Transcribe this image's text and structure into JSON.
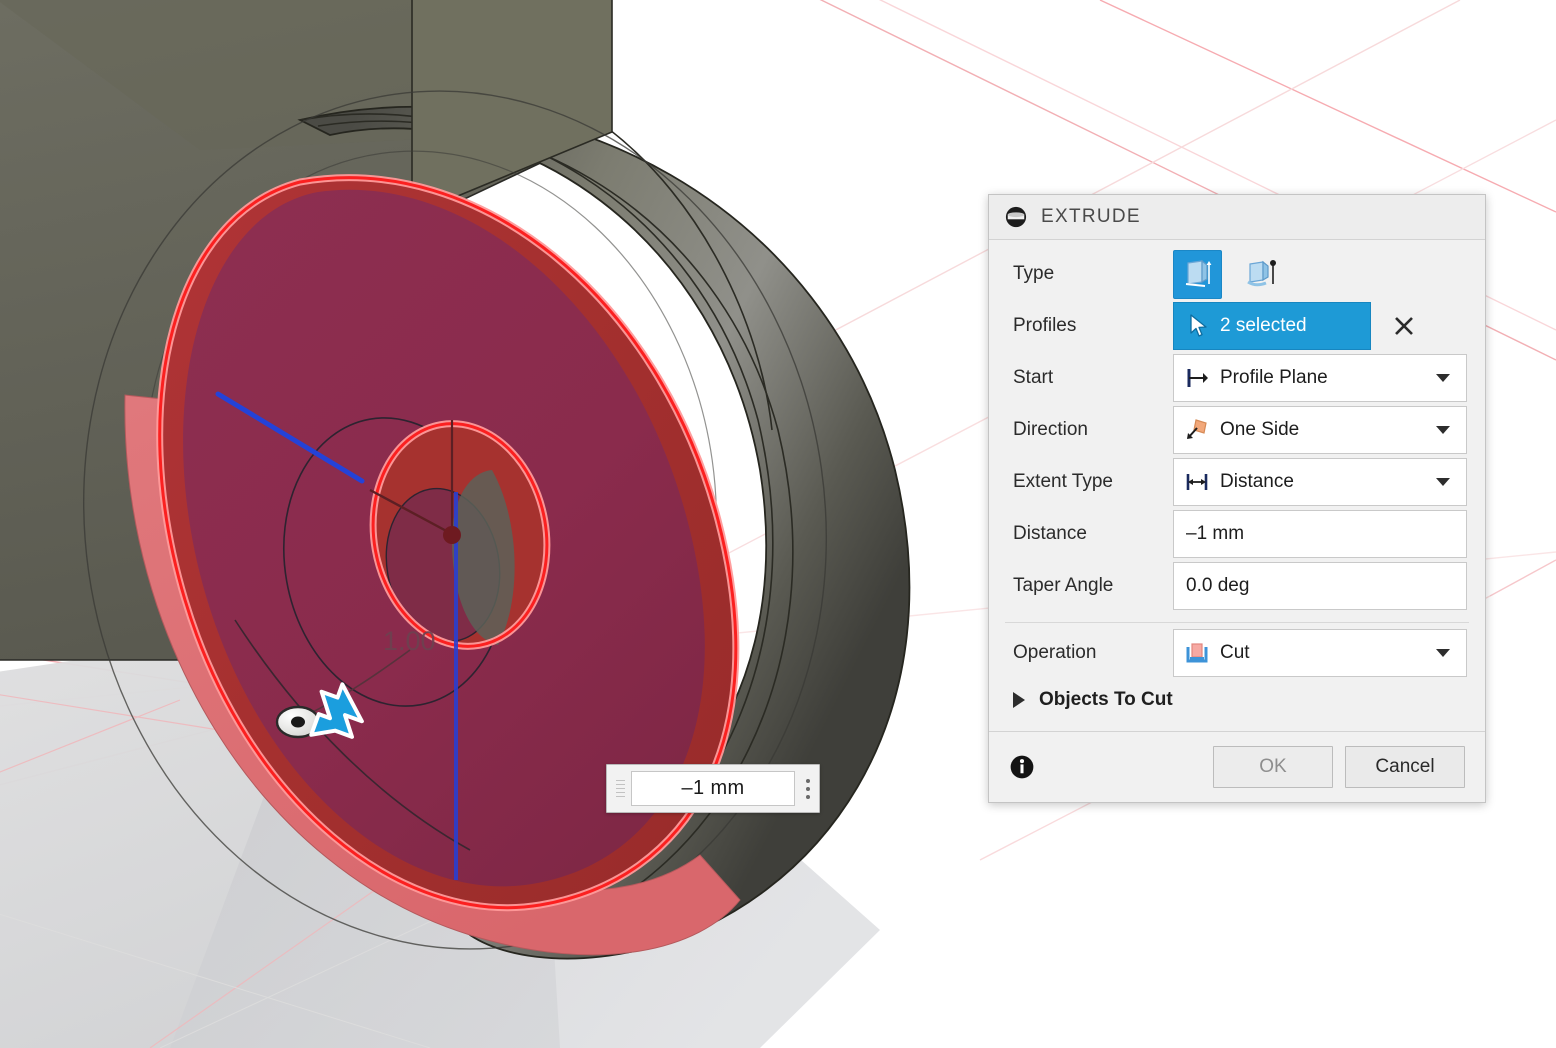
{
  "app": {
    "viewport_background": "#ffffff",
    "grid_line_color": "#f4b8bc",
    "accent_blue": "#1e9ad6",
    "highlight_red": "#fb2f2f",
    "body_color": "#6b6b5e",
    "selected_face_color": "#8e2c4d"
  },
  "viewport": {
    "dimension_label": "1.00",
    "cursor": "arrow-cursor",
    "manipulator": {
      "name": "distance-manipulator",
      "value": "–1 mm",
      "grip": "drag-grip",
      "menu": "more-options-dots"
    }
  },
  "dialog": {
    "title": "EXTRUDE",
    "title_icon": "extrude-feature-icon",
    "rows": {
      "type": {
        "label": "Type",
        "options": [
          {
            "name": "extrude-profile-icon",
            "selected": true
          },
          {
            "name": "extrude-tapered-icon",
            "selected": false
          }
        ]
      },
      "profiles": {
        "label": "Profiles",
        "value": "2 selected",
        "icon": "selection-cursor-icon",
        "clear": "✕"
      },
      "start": {
        "label": "Start",
        "value": "Profile Plane",
        "icon": "profile-plane-icon"
      },
      "direction": {
        "label": "Direction",
        "value": "One Side",
        "icon": "one-side-icon"
      },
      "extent_type": {
        "label": "Extent Type",
        "value": "Distance",
        "icon": "distance-icon"
      },
      "distance": {
        "label": "Distance",
        "value": "–1 mm"
      },
      "taper_angle": {
        "label": "Taper Angle",
        "value": "0.0 deg"
      },
      "operation": {
        "label": "Operation",
        "value": "Cut",
        "icon": "cut-operation-icon"
      }
    },
    "section": {
      "label": "Objects To Cut",
      "expanded": false
    },
    "footer": {
      "info": "info-icon",
      "ok": "OK",
      "cancel": "Cancel"
    }
  }
}
